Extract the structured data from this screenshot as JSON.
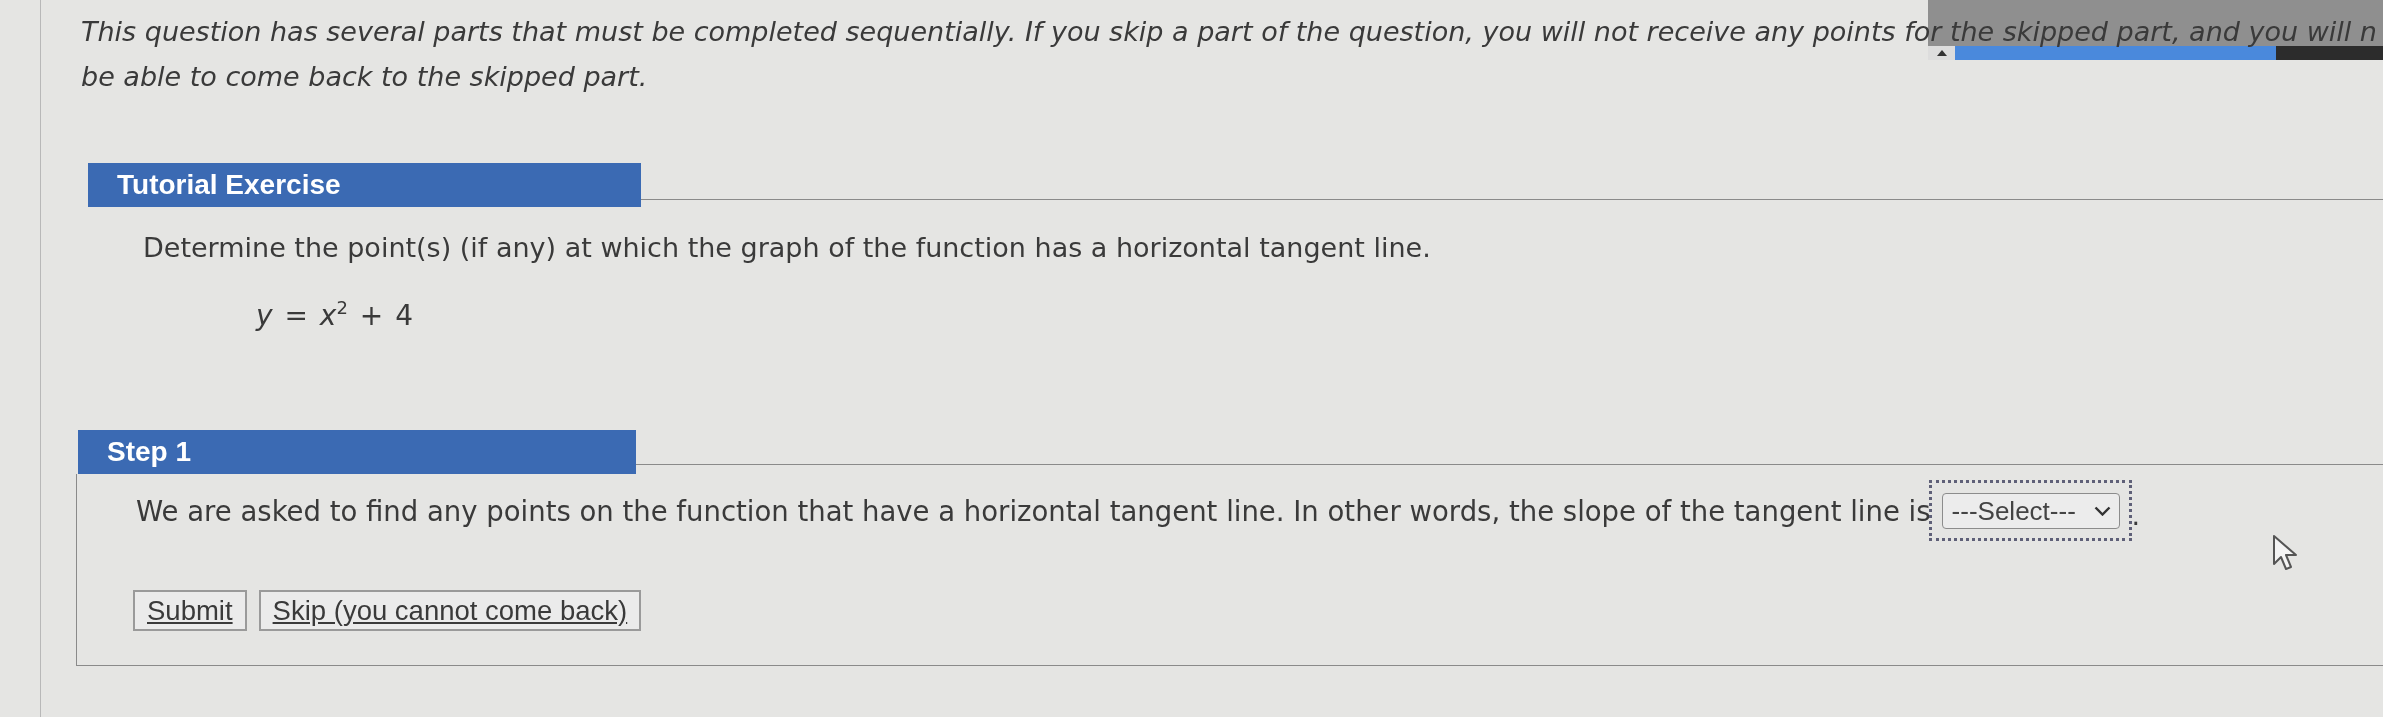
{
  "notice": {
    "lines": [
      "This question has several parts that must be completed sequentially. If you skip a part of the question, you will not receive any points for the skipped part, and you will n",
      "be able to come back to the skipped part."
    ]
  },
  "overlay": {
    "progress": {
      "level": 0.75
    }
  },
  "tutorial": {
    "title": "Tutorial Exercise",
    "question": "Determine the point(s) (if any) at which the graph of the function has a horizontal tangent line.",
    "equation": "*y* = *x*$^{2}$ + 4"
  },
  "step": {
    "title": "Step 1",
    "text": "We are asked to find any points on the function that have a horizontal tangent line. In other words, the slope of the tangent line is",
    "answer": {
      "value": "---Select---",
      "focused": true
    },
    "after": "."
  },
  "buttons": [
    {
      "label": "Submit"
    },
    {
      "label": "Skip (you cannot come back)"
    }
  ]
}
